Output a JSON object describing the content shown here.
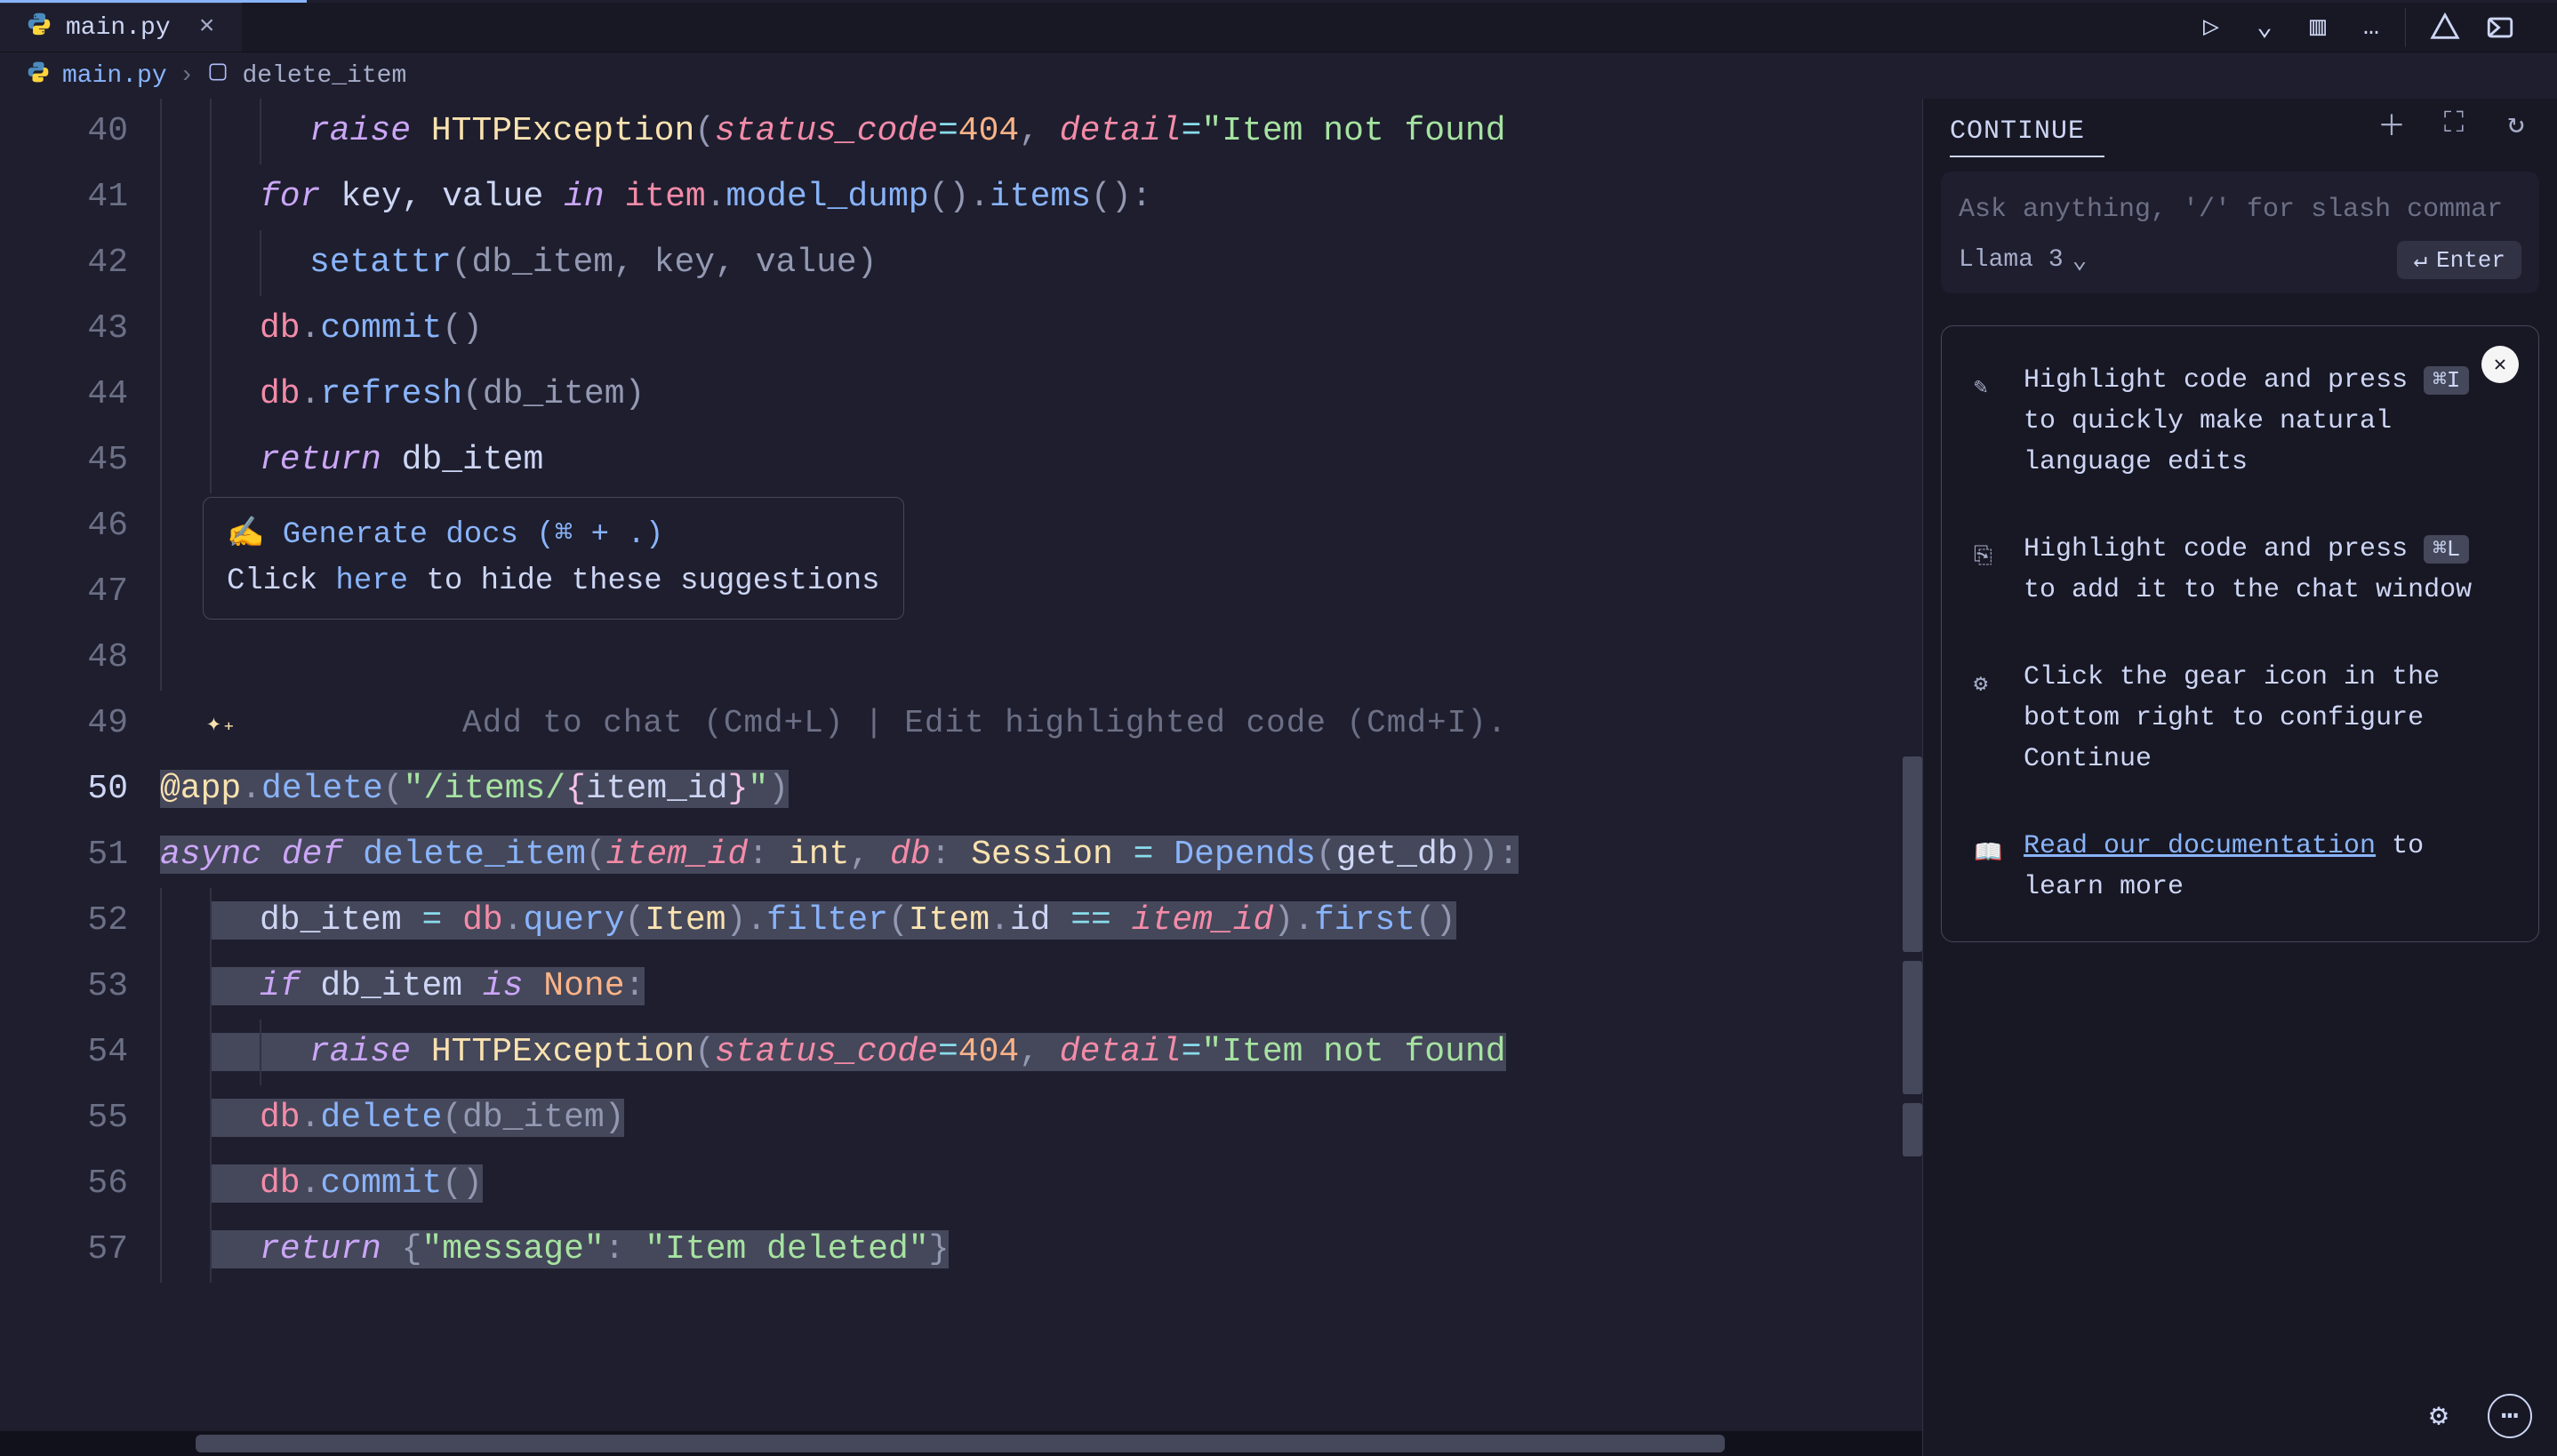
{
  "tab": {
    "filename": "main.py",
    "close_glyph": "×"
  },
  "breadcrumb": {
    "file": "main.py",
    "symbol": "delete_item",
    "sep1": "›",
    "sep2": "›"
  },
  "editor_actions": {
    "run": "▷",
    "chevron": "⌄",
    "split": "▥",
    "more": "…"
  },
  "side_toggles": {
    "continue_icon": "⟲",
    "panel2": "▭"
  },
  "gutter_lines": [
    "40",
    "41",
    "42",
    "43",
    "44",
    "45",
    "46",
    "47",
    "48",
    "49",
    "50",
    "51",
    "52",
    "53",
    "54",
    "55",
    "56",
    "57"
  ],
  "gutter_active": "50",
  "code": {
    "l40": {
      "pre": "        ",
      "kw": "raise",
      "sp": " ",
      "exc": "HTTPException",
      "open": "(",
      "p1": "status_code",
      "eq": "=",
      "num": "404",
      "comma": ", ",
      "p2": "detail",
      "eq2": "=",
      "str": "\"Item not found"
    },
    "l41": {
      "pre": "    ",
      "for": "for",
      "vars": " key, value ",
      "in": "in",
      "call": " item.model_dump().items():",
      "obj": "item",
      "dot": ".",
      "m1": "model_dump",
      "paren1": "()",
      "dot2": ".",
      "m2": "items",
      "paren2": "():"
    },
    "l42": {
      "pre": "        ",
      "fn": "setattr",
      "args": "(db_item, key, value)"
    },
    "l43": {
      "pre": "    ",
      "obj": "db",
      "dot": ".",
      "m": "commit",
      "paren": "()"
    },
    "l44": {
      "pre": "    ",
      "obj": "db",
      "dot": ".",
      "m": "refresh",
      "paren": "(db_item)"
    },
    "l45": {
      "pre": "    ",
      "kw": "return",
      "sp": " ",
      "v": "db_item"
    },
    "l49_codelens": "Add to chat (Cmd+L) | Edit highlighted code (Cmd+I).",
    "l50": {
      "at": "@app",
      "dot": ".",
      "m": "delete",
      "open": "(",
      "q": "\"",
      "s1": "/items/",
      "lb": "{",
      "var": "item_id",
      "rb": "}",
      "q2": "\"",
      "close": ")"
    },
    "l51": {
      "async": "async",
      "sp": " ",
      "def": "def",
      "sp2": " ",
      "name": "delete_item",
      "open": "(",
      "p1": "item_id",
      "colon": ": ",
      "t1": "int",
      "comma": ", ",
      "p2": "db",
      "colon2": ": ",
      "t2": "Session",
      "eq": " = ",
      "fn": "Depends",
      "open2": "(",
      "arg": "get_db",
      "close2": ")",
      "close": "):"
    },
    "l52": {
      "pre": "    ",
      "v": "db_item",
      "eq": " = ",
      "obj": "db",
      "dot": ".",
      "m1": "query",
      "open": "(",
      "t": "Item",
      "close": ")",
      "dot2": ".",
      "m2": "filter",
      "open2": "(",
      "t2": "Item",
      "dot3": ".",
      "attr": "id",
      "op": " == ",
      "p": "item_id",
      "close2": ")",
      "dot4": ".",
      "m3": "first",
      "paren": "()"
    },
    "l53": {
      "pre": "    ",
      "if": "if",
      "sp": " ",
      "v": "db_item",
      "sp2": " ",
      "is": "is",
      "sp3": " ",
      "none": "None",
      "colon": ":"
    },
    "l54": {
      "pre": "        ",
      "kw": "raise",
      "sp": " ",
      "exc": "HTTPException",
      "open": "(",
      "p1": "status_code",
      "eq": "=",
      "num": "404",
      "comma": ", ",
      "p2": "detail",
      "eq2": "=",
      "str": "\"Item not found"
    },
    "l55": {
      "pre": "    ",
      "obj": "db",
      "dot": ".",
      "m": "delete",
      "paren": "(db_item)"
    },
    "l56": {
      "pre": "    ",
      "obj": "db",
      "dot": ".",
      "m": "commit",
      "paren": "()"
    },
    "l57": {
      "pre": "    ",
      "kw": "return",
      "sp": " ",
      "lb": "{",
      "q": "\"",
      "key": "message",
      "q2": "\"",
      "colon": ": ",
      "q3": "\"",
      "val": "Item deleted",
      "q4": "\"",
      "rb": "}"
    }
  },
  "suggestion": {
    "emoji": "✍️",
    "text": "Generate docs (⌘ + .)",
    "hint_pre": "Click ",
    "hint_link": "here",
    "hint_post": " to hide these suggestions"
  },
  "sparkle": "✦₊",
  "continue": {
    "title": "CONTINUE",
    "header_icons": {
      "new": "＋",
      "expand": "⛶",
      "history": "↻"
    },
    "chat_placeholder": "Ask anything, '/' for slash commar",
    "model": "Llama 3",
    "model_chevron": "⌄",
    "enter_glyph": "↵",
    "enter_label": "Enter",
    "tips": [
      {
        "icon": "✎",
        "pre": "Highlight code and press ",
        "kbd": "⌘I",
        "post": " to quickly make natural language edits"
      },
      {
        "icon": "⎘",
        "pre": "Highlight code and press ",
        "kbd": "⌘L",
        "post": " to add it to the chat window"
      },
      {
        "icon": "⚙",
        "pre": "Click the gear icon in the bottom right to configure Continue",
        "kbd": "",
        "post": ""
      },
      {
        "icon": "📖",
        "link": "Read our documentation",
        "post": " to learn more"
      }
    ],
    "close_x": "✕",
    "footer": {
      "gear": "⚙",
      "more": "⋯"
    }
  }
}
